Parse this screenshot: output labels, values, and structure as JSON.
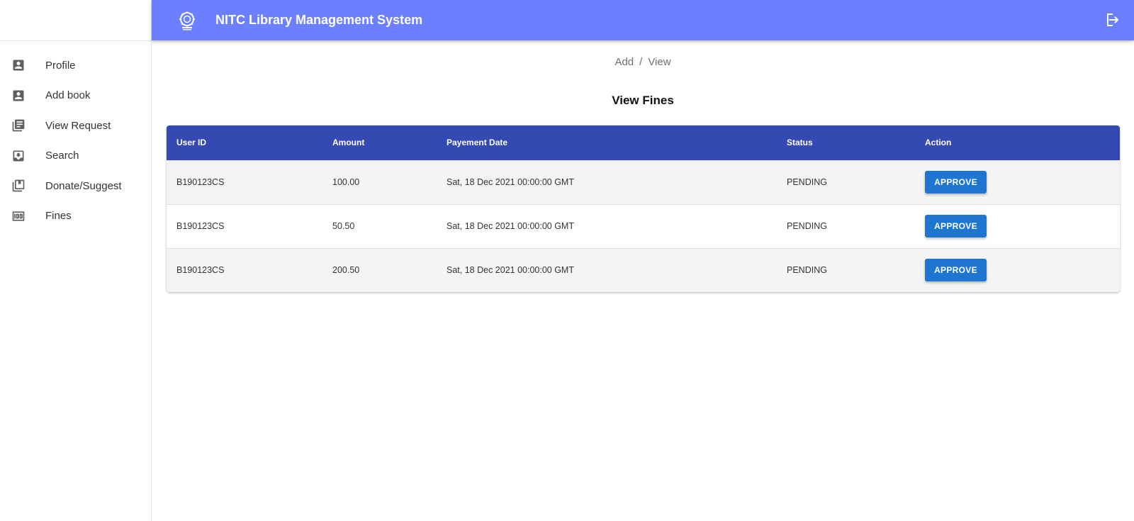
{
  "header": {
    "title": "NITC Library Management System",
    "logo_icon": "nitc-emblem-icon",
    "logout_icon": "logout-icon",
    "color": "#6b7fff"
  },
  "sidebar": {
    "items": [
      {
        "label": "Profile",
        "icon": "account-box-icon"
      },
      {
        "label": "Add book",
        "icon": "account-box-icon"
      },
      {
        "label": "View Request",
        "icon": "library-books-icon"
      },
      {
        "label": "Search",
        "icon": "move-to-inbox-icon"
      },
      {
        "label": "Donate/Suggest",
        "icon": "library-add-icon"
      },
      {
        "label": "Fines",
        "icon": "money-icon"
      }
    ]
  },
  "breadcrumb": {
    "first": "Add",
    "separator": "/",
    "second": "View"
  },
  "page": {
    "title": "View Fines"
  },
  "table": {
    "header_color": "#3549b3",
    "columns": [
      "User ID",
      "Amount",
      "Payement Date",
      "Status",
      "Action"
    ],
    "rows": [
      {
        "user_id": "B190123CS",
        "amount": "100.00",
        "date": "Sat, 18 Dec 2021 00:00:00 GMT",
        "status": "PENDING",
        "action": "APPROVE"
      },
      {
        "user_id": "B190123CS",
        "amount": "50.50",
        "date": "Sat, 18 Dec 2021 00:00:00 GMT",
        "status": "PENDING",
        "action": "APPROVE"
      },
      {
        "user_id": "B190123CS",
        "amount": "200.50",
        "date": "Sat, 18 Dec 2021 00:00:00 GMT",
        "status": "PENDING",
        "action": "APPROVE"
      }
    ]
  },
  "button_color": "#1f76d2"
}
